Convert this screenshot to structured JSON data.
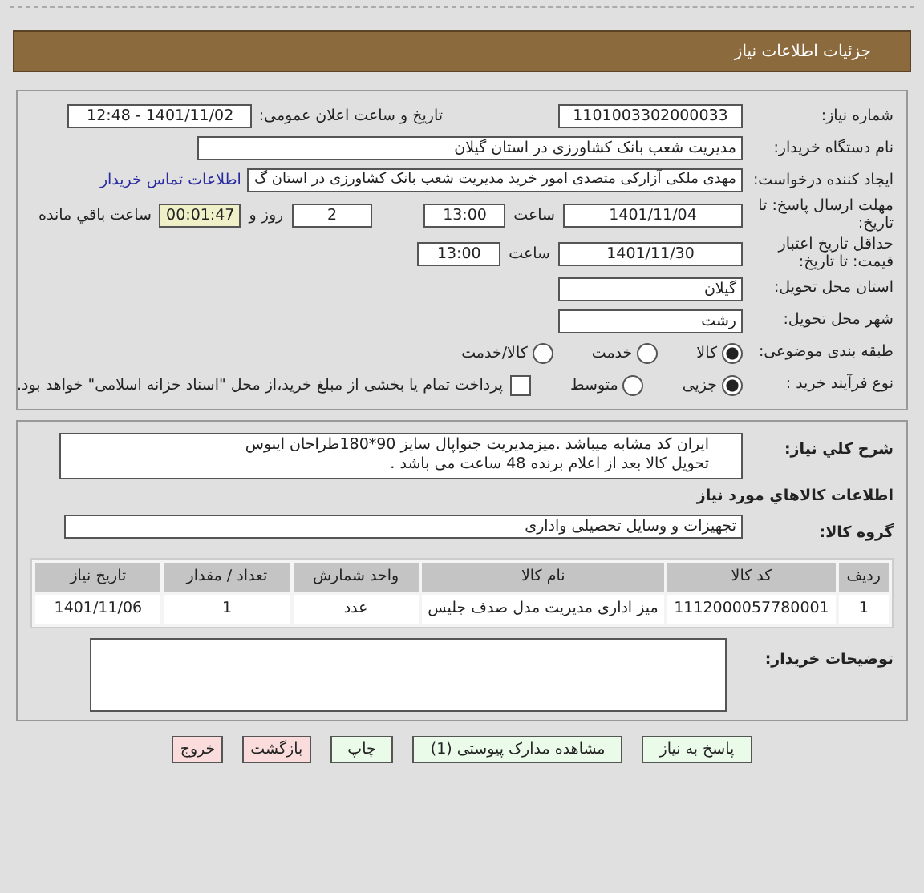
{
  "header": {
    "title": "جزئیات اطلاعات نیاز"
  },
  "need": {
    "number_label": "شماره نیاز:",
    "number": "1101003302000033",
    "announce_label": "تاریخ و ساعت اعلان عمومی:",
    "announce": "1401/11/02 - 12:48"
  },
  "buyer": {
    "label": "نام دستگاه خریدار:",
    "value": "مدیریت شعب بانک کشاورزی در استان گیلان"
  },
  "requester": {
    "label": "ایجاد کننده درخواست:",
    "value": "مهدی ملکی آزارکی متصدی امور خرید مدیریت شعب بانک کشاورزی در استان گ",
    "contact_link": "اطلاعات تماس خریدار"
  },
  "deadline": {
    "label": "مهلت ارسال پاسخ: تا تاریخ:",
    "date": "1401/11/04",
    "time_label": "ساعت",
    "time": "13:00",
    "days": "2",
    "days_label": "روز و",
    "remaining": "00:01:47",
    "remaining_label": "ساعت باقي مانده"
  },
  "validity": {
    "label": "حداقل تاریخ اعتبار قیمت: تا تاریخ:",
    "date": "1401/11/30",
    "time_label": "ساعت",
    "time": "13:00"
  },
  "province": {
    "label": "استان محل تحویل:",
    "value": "گیلان"
  },
  "city": {
    "label": "شهر محل تحویل:",
    "value": "رشت"
  },
  "category": {
    "label": "طبقه بندی موضوعی:",
    "options": [
      {
        "label": "کالا",
        "selected": true
      },
      {
        "label": "خدمت",
        "selected": false
      },
      {
        "label": "کالا/خدمت",
        "selected": false
      }
    ]
  },
  "process": {
    "label": "نوع فرآیند خرید :",
    "options": [
      {
        "label": "جزیی",
        "selected": true
      },
      {
        "label": "متوسط",
        "selected": false
      }
    ],
    "treasury": {
      "checked": false,
      "label": "پرداخت تمام یا بخشی از مبلغ خرید،از محل \"اسناد خزانه اسلامی\" خواهد بود."
    }
  },
  "description": {
    "label": "شرح کلي نیاز:",
    "lines": [
      "ایران کد مشابه میباشد .میزمدیریت جنواپال سایز 90*180طراحان اینوس",
      "تحویل کالا بعد از اعلام برنده 48 ساعت می باشد ."
    ]
  },
  "goods_title": "اطلاعات کالاهاي مورد نیاز",
  "group": {
    "label": "گروه کالا:",
    "value": "تجهیزات و وسایل تحصیلی واداری"
  },
  "table": {
    "columns": [
      "ردیف",
      "کد کالا",
      "نام کالا",
      "واحد شمارش",
      "تعداد / مقدار",
      "تاریخ نیاز"
    ],
    "rows": [
      [
        "1",
        "1112000057780001",
        "میز اداری مدیریت مدل صدف جلیس",
        "عدد",
        "1",
        "1401/11/06"
      ]
    ]
  },
  "notes": {
    "label": "توضیحات خریدار:"
  },
  "buttons": [
    {
      "label": "پاسخ به نیاز",
      "kind": "action"
    },
    {
      "label": "مشاهده مدارک پیوستی (1)",
      "kind": "action"
    },
    {
      "label": "چاپ",
      "kind": "action"
    },
    {
      "label": "بازگشت",
      "kind": "exit"
    },
    {
      "label": "خروج",
      "kind": "exit"
    }
  ]
}
